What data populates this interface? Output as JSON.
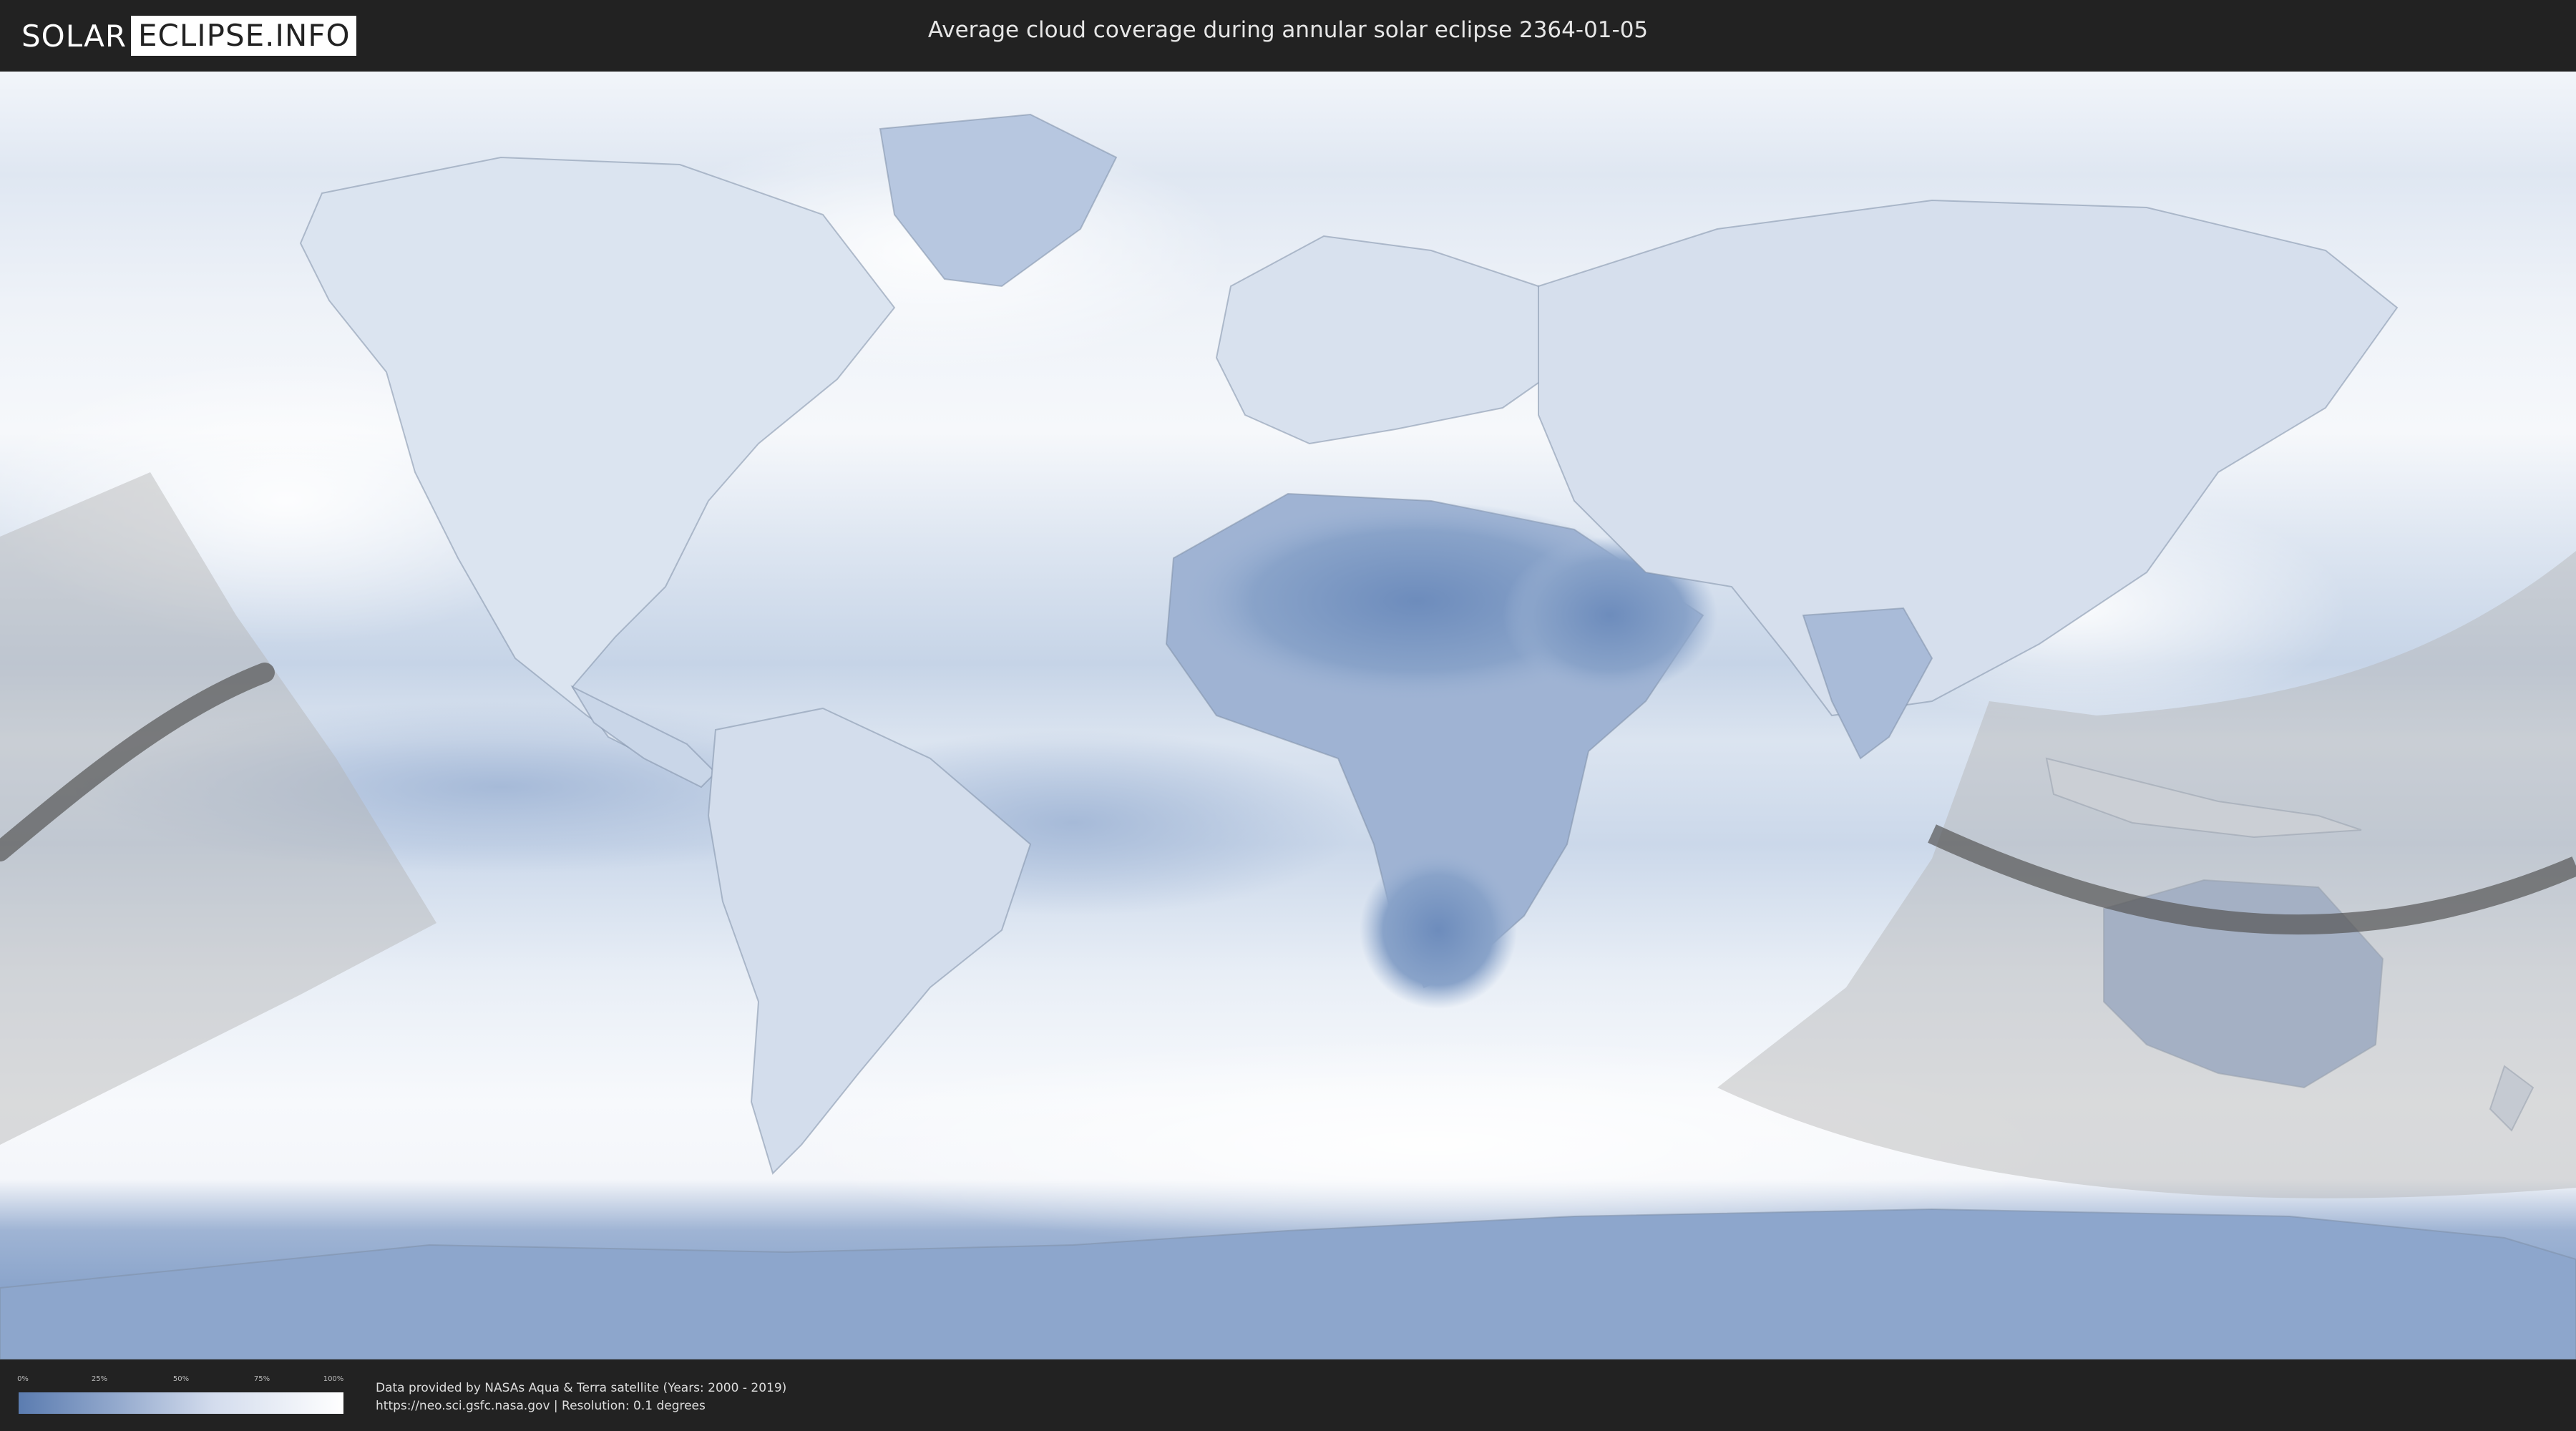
{
  "header": {
    "logo_left": "SOLAR",
    "logo_right": "ECLIPSE.INFO",
    "title": "Average cloud coverage during annular solar eclipse 2364-01-05"
  },
  "legend": {
    "ticks": [
      "0%",
      "25%",
      "50%",
      "75%",
      "100%"
    ],
    "gradient_colors": [
      "#5b7cb0",
      "#93a9cd",
      "#d3dced",
      "#ffffff"
    ]
  },
  "footer": {
    "credit_line_1": "Data provided by NASAs Aqua & Terra satellite (Years: 2000 - 2019)",
    "credit_line_2": "https://neo.sci.gsfc.nasa.gov | Resolution: 0.1 degrees"
  },
  "colors": {
    "header_bg": "#222222",
    "ocean_clear": "#7f9cc6",
    "cloud_white": "#f4f7fb",
    "penumbra": "#b4b4b4",
    "central_path": "#555555"
  }
}
